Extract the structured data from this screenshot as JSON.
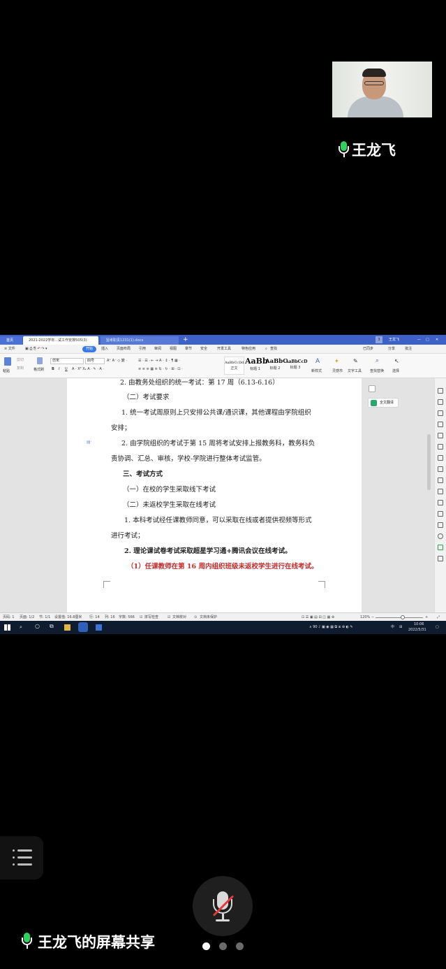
{
  "participant": {
    "name": "王龙飞"
  },
  "shared_screen": {
    "tabs": [
      {
        "label": "首页"
      },
      {
        "label": "2021-2022学年...试工作安排505(3)"
      },
      {
        "label": "监考职责1231(1).docx"
      }
    ],
    "title_right": {
      "badge": "3",
      "user": "王龙飞"
    },
    "menu": [
      "≡ 文件",
      "开始",
      "插入",
      "页面布局",
      "引用",
      "审阅",
      "视图",
      "章节",
      "安全",
      "开发工具",
      "特色应用",
      "查找"
    ],
    "menu_right": [
      "已同步",
      "分享",
      "批注"
    ],
    "ribbon": {
      "paste": "粘贴",
      "cut": "剪切",
      "copy": "复制",
      "format_painter": "格式刷",
      "font_name": "仿宋",
      "font_size": "四号",
      "styles": [
        {
          "sample": "AaBbCcDd",
          "name": "正文"
        },
        {
          "sample": "AaBb",
          "name": "标题 1"
        },
        {
          "sample": "AaBbC",
          "name": "标题 2"
        },
        {
          "sample": "AaBbCcD",
          "name": "标题 3"
        }
      ],
      "new_style": "新样式",
      "text_tools": "文字工具",
      "find_replace": "查找替换",
      "select": "选择",
      "brush": "灵感市"
    },
    "document": {
      "lines": [
        {
          "text": "2. 由教务处组织的统一考试：第 17 周（6.13-6.16）"
        },
        {
          "text": "（二）考试要求"
        },
        {
          "text": "1. 统一考试周原则上只安排公共课/通识课，其他课程由学院组织"
        },
        {
          "text": "安排；"
        },
        {
          "text": "2. 由学院组织的考试于第 15 周将考试安排上报教务科，教务科负"
        },
        {
          "text": "责协调、汇总、审核，学校-学院进行整体考试监管。"
        },
        {
          "text": "三、考试方式"
        },
        {
          "text": "（一）在校的学生采取线下考试"
        },
        {
          "text": "（二）未返校学生采取在线考试"
        },
        {
          "text": "1. 本科考试经任课教师同意，可以采取在线或者提供视频等形式"
        },
        {
          "text": "进行考试；"
        },
        {
          "text": "2. 理论课试卷考试采取超星学习通+腾讯会议在线考试。"
        },
        {
          "text": "（1）任课教师在第 16 周内组织班级未返校学生进行在线考试。"
        }
      ]
    },
    "side_panel": {
      "translate": "全文翻译"
    },
    "status": {
      "page_num": "页码: 1",
      "pages": "页面: 1/2",
      "section": "节: 1/1",
      "position": "设置值: 16.8厘米",
      "row": "行: 14",
      "col": "列: 16",
      "words": "字数: 566",
      "spell": "拼写检查",
      "proof": "文档校对",
      "protect": "文档未保护",
      "zoom": "120%",
      "zoom_value": 0.58
    },
    "taskbar": {
      "time": "10:06",
      "date": "2022/5/31",
      "lang": "中"
    }
  },
  "bottom": {
    "share_label": "王龙飞的屏幕共享",
    "page_count": 3,
    "active_page": 1
  },
  "colors": {
    "mic_active": "#2fd25d",
    "mute_slash": "#e23b3b",
    "wps_blue": "#3d61c6",
    "doc_red": "#c32b2b"
  }
}
